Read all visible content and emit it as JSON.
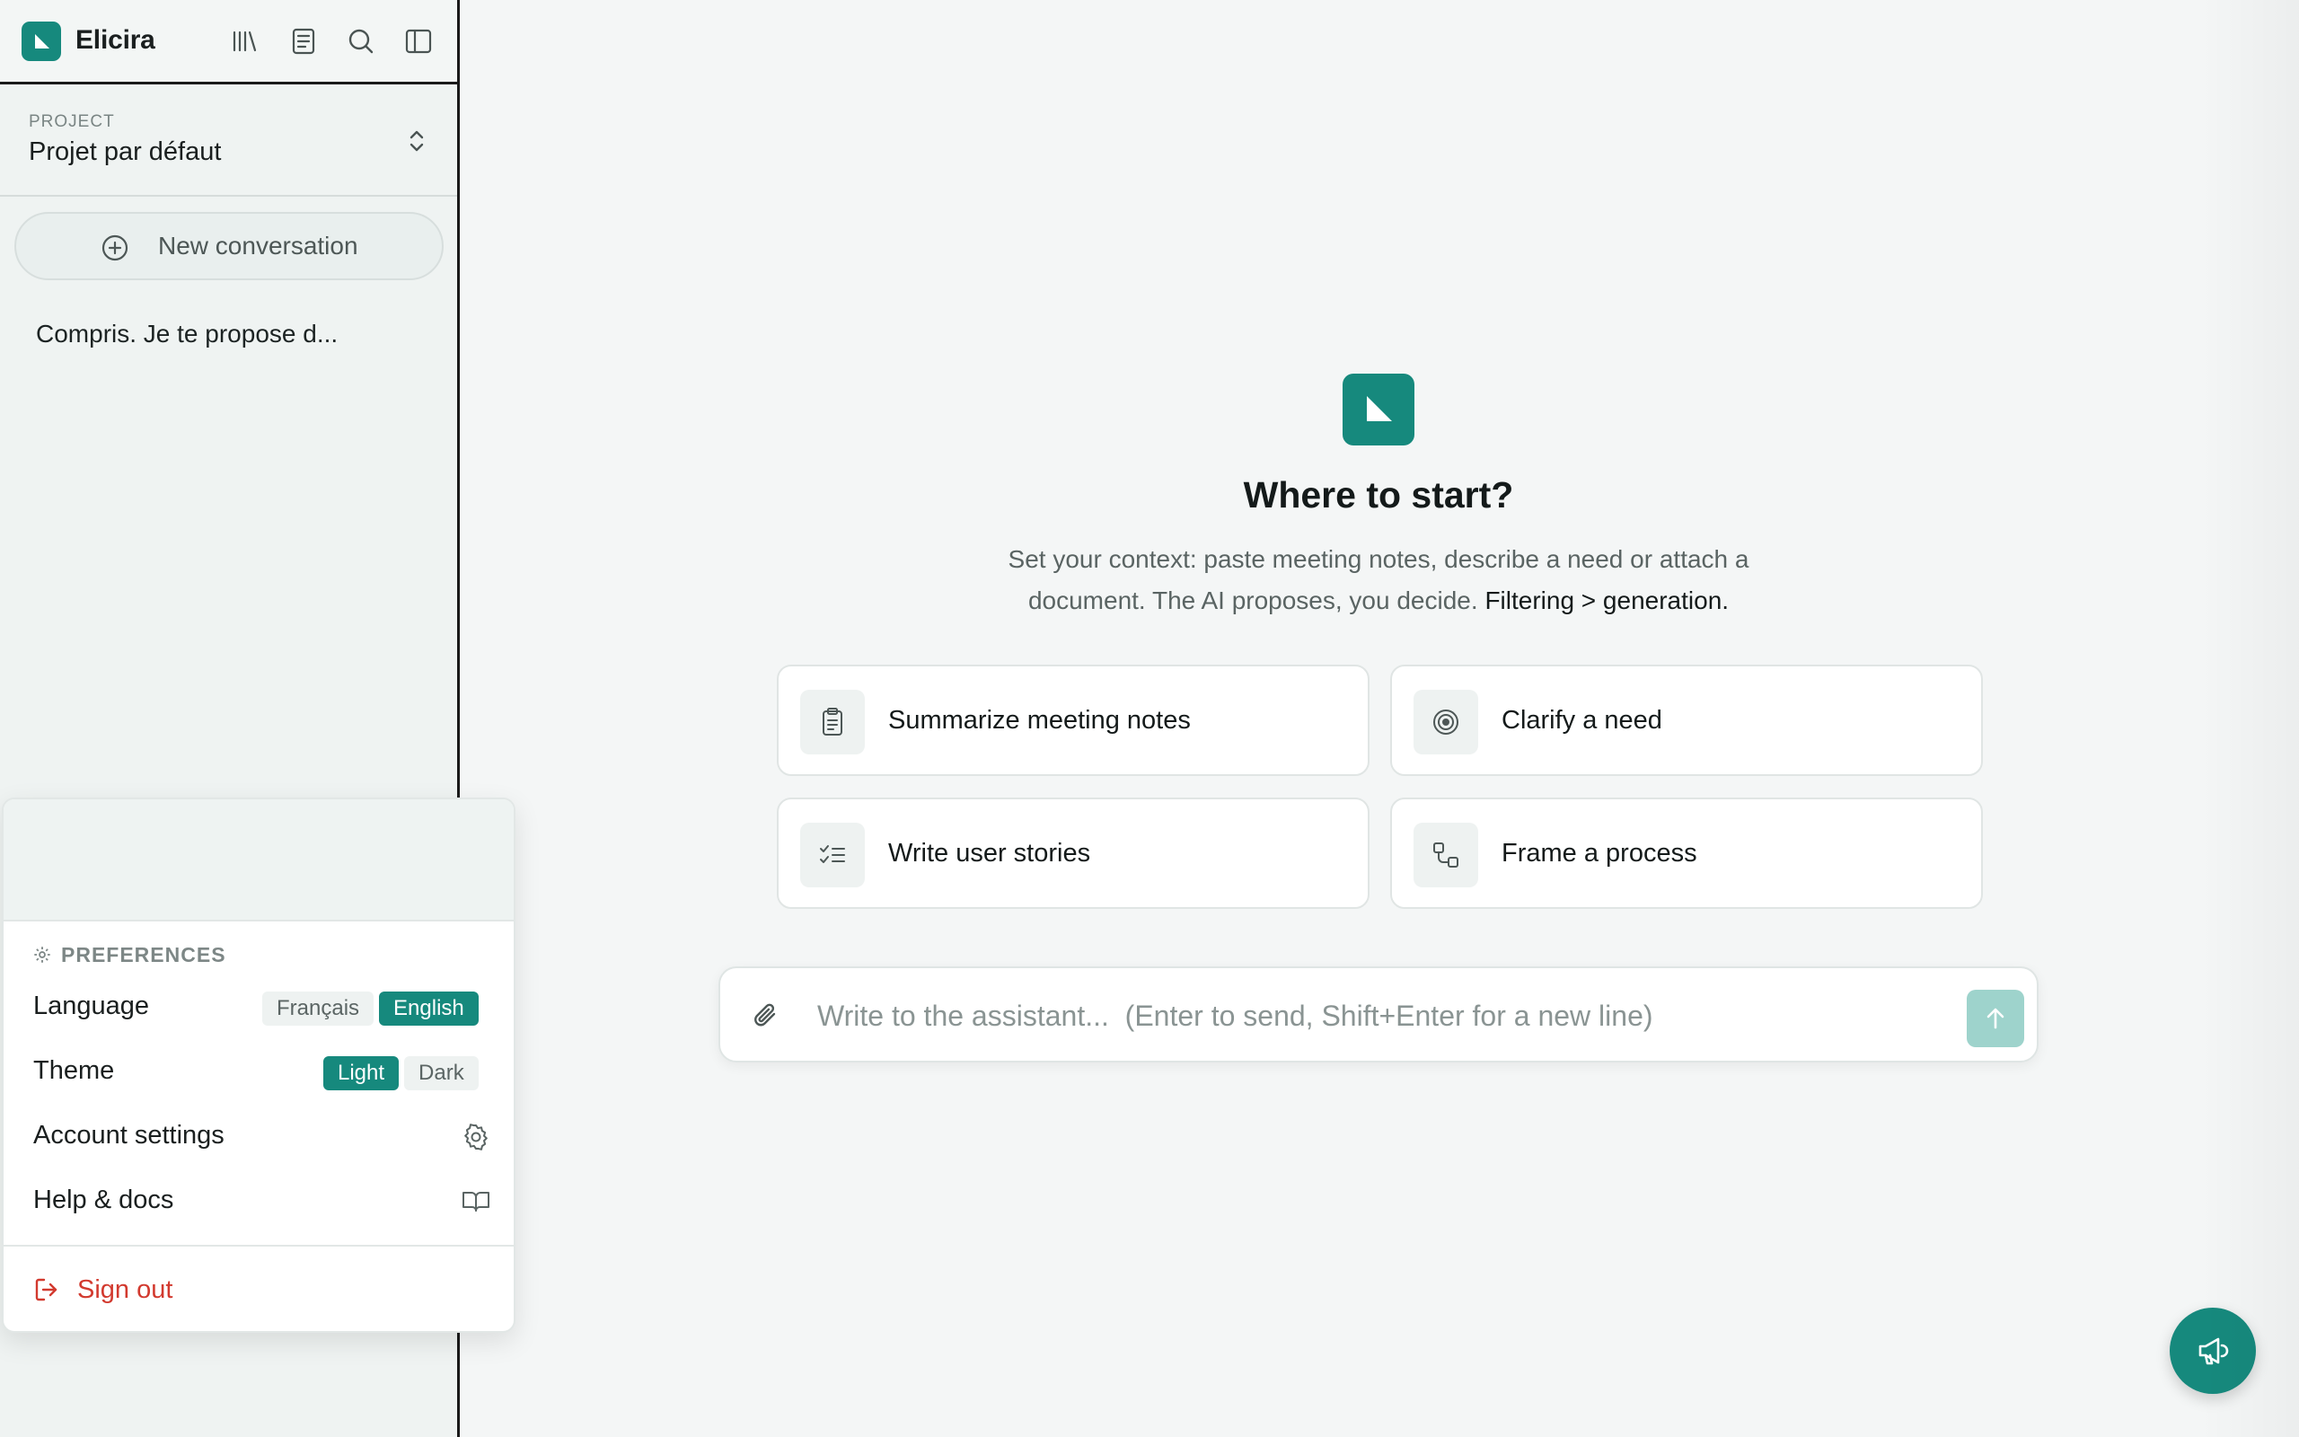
{
  "app": {
    "brand": "Elicira",
    "accent_color": "#16897d",
    "header_icons": [
      "library-icon",
      "document-icon",
      "search-icon",
      "sidebar-toggle-icon"
    ]
  },
  "project": {
    "label": "PROJECT",
    "name": "Projet par défaut"
  },
  "sidebar": {
    "new_conversation": "New conversation",
    "conversations": [
      "Compris. Je te propose d..."
    ]
  },
  "menu": {
    "preferences_heading": "PREFERENCES",
    "language": {
      "label": "Language",
      "options": [
        "Français",
        "English"
      ],
      "selected": "English"
    },
    "theme": {
      "label": "Theme",
      "options": [
        "Light",
        "Dark"
      ],
      "selected": "Light"
    },
    "account_settings": "Account settings",
    "help_docs": "Help & docs",
    "sign_out": "Sign out",
    "sign_out_color": "#d23a2f"
  },
  "main": {
    "title": "Where to start?",
    "subtitle_plain": "Set your context: paste meeting notes, describe a need or attach a document. The AI proposes, you decide.",
    "subtitle_emphasis": "Filtering > generation.",
    "suggestions": [
      {
        "label": "Summarize meeting notes",
        "icon": "clipboard-icon"
      },
      {
        "label": "Clarify a need",
        "icon": "target-icon"
      },
      {
        "label": "Write user stories",
        "icon": "checklist-icon"
      },
      {
        "label": "Frame a process",
        "icon": "workflow-icon"
      }
    ],
    "composer": {
      "placeholder": "Write to the assistant...  (Enter to send, Shift+Enter for a new line)",
      "value": ""
    }
  }
}
